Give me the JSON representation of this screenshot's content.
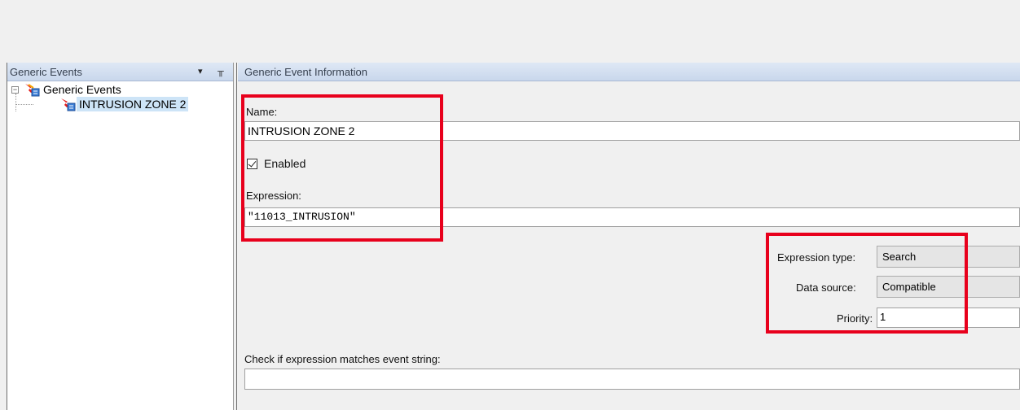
{
  "left_pane": {
    "title": "Generic Events",
    "dropdown_glyph": "▾",
    "pin_glyph": "╥",
    "tree": {
      "root_label": "Generic Events",
      "root_expander": "−",
      "child_label": "INTRUSION ZONE 2"
    }
  },
  "right_pane": {
    "title": "Generic Event Information",
    "name_label": "Name:",
    "name_value": "INTRUSION ZONE 2",
    "enabled_label": "Enabled",
    "enabled_checked": true,
    "expression_label": "Expression:",
    "expression_value": "\"11013_INTRUSION\"",
    "expression_type_label": "Expression type:",
    "expression_type_value": "Search",
    "data_source_label": "Data source:",
    "data_source_value": "Compatible",
    "priority_label": "Priority:",
    "priority_value": "1",
    "check_label": "Check if expression matches event string:",
    "check_value": ""
  },
  "colors": {
    "highlight_box": "#e8001c",
    "selection": "#cde4f7",
    "header_gradient_top": "#dfe8f5",
    "header_gradient_bottom": "#c9d7ec"
  },
  "icons": {
    "event": "generic-event-icon",
    "dropdown": "chevron-down-icon",
    "pin": "pin-icon",
    "expander": "collapse-icon"
  }
}
